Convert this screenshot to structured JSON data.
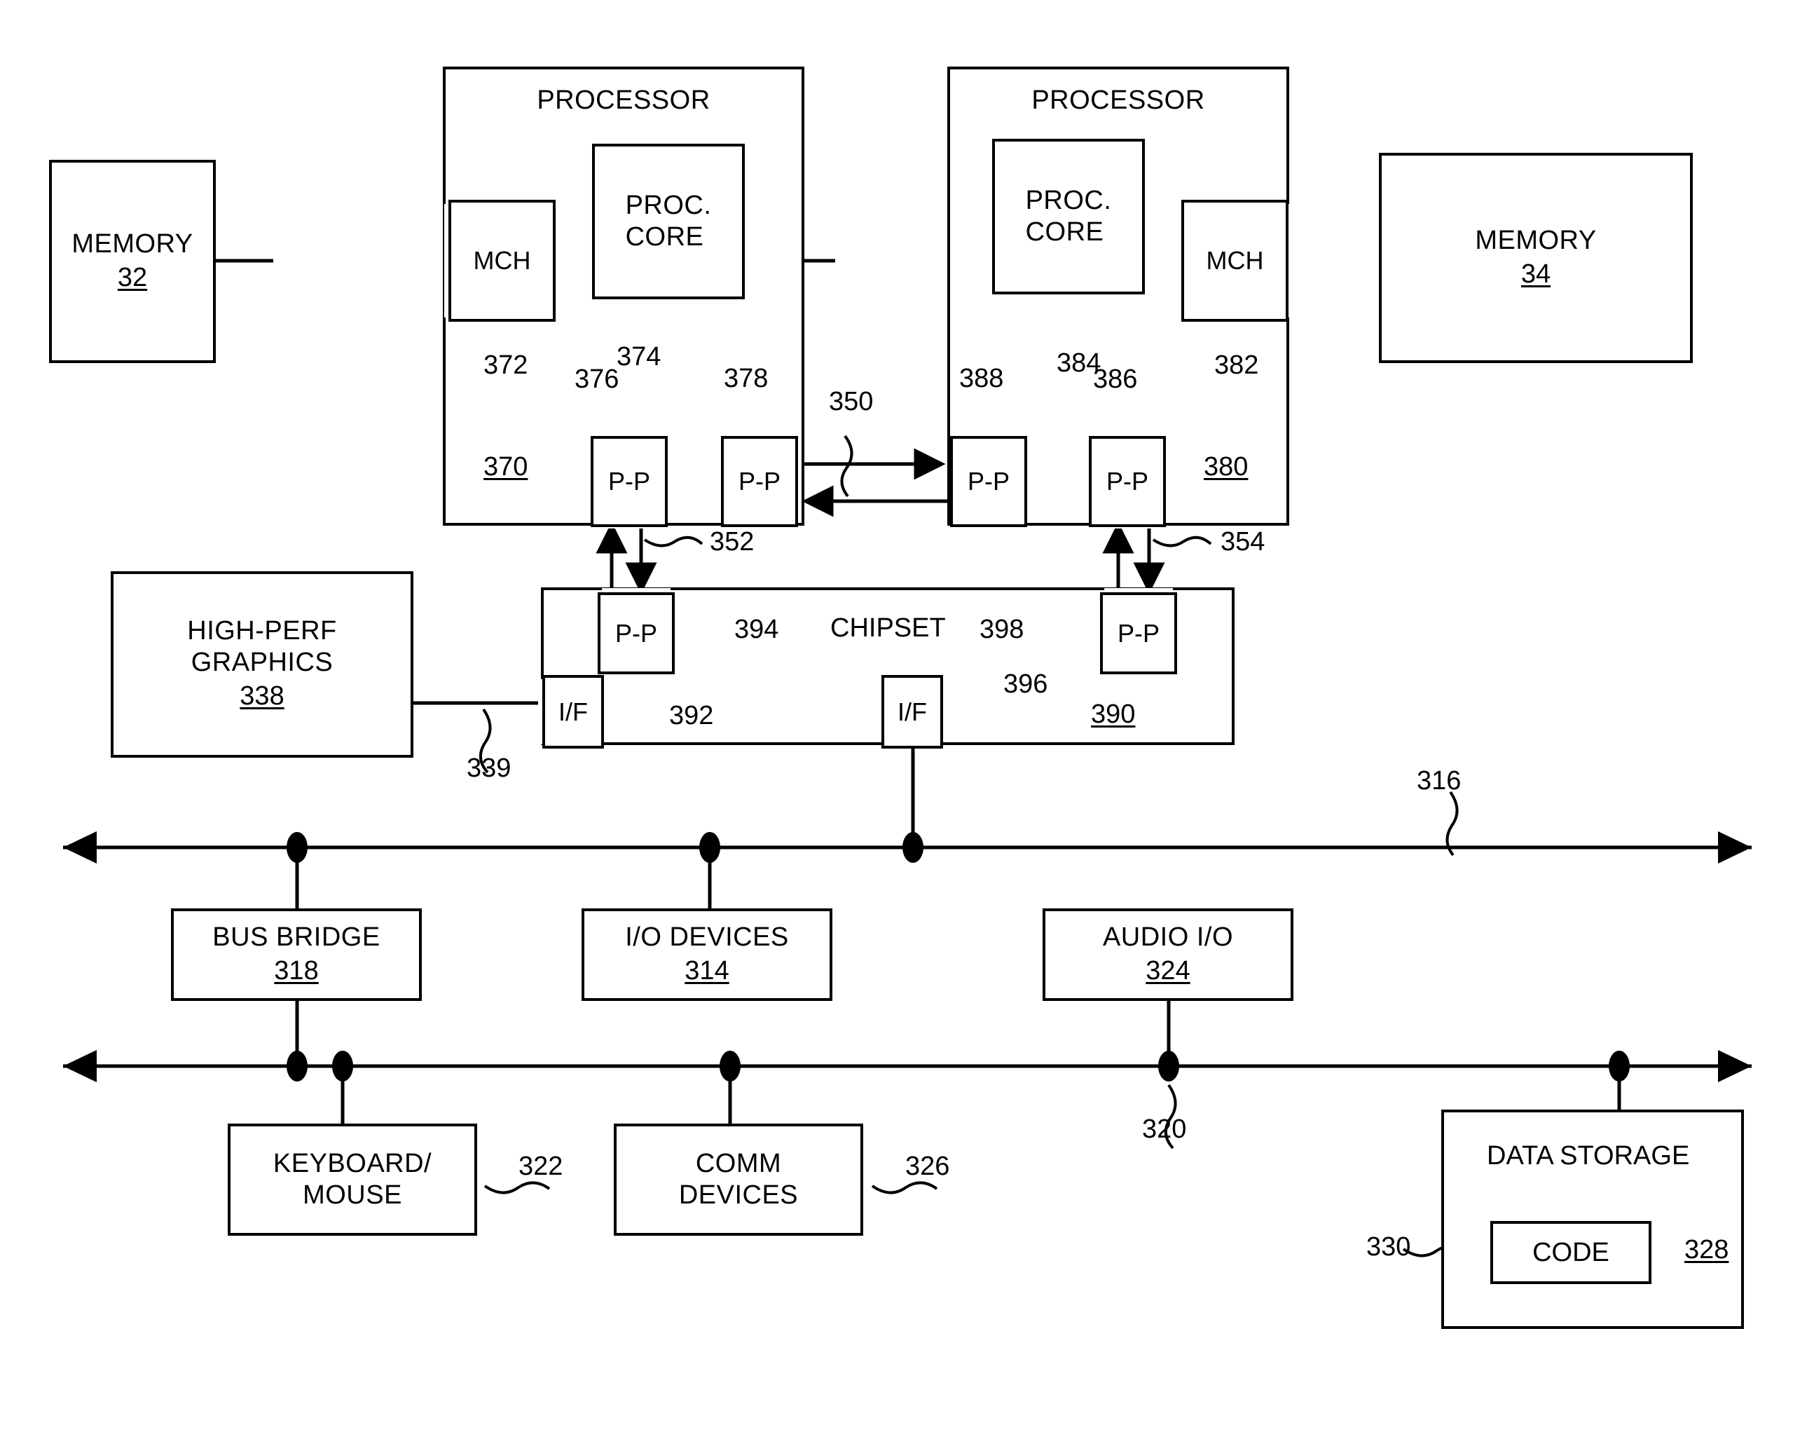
{
  "figure": {
    "type": "patent-block-diagram",
    "description": "Multiprocessor point-to-point interconnect system block diagram"
  },
  "blocks": {
    "memory_left": {
      "title": "MEMORY",
      "ref": "32"
    },
    "memory_right": {
      "title": "MEMORY",
      "ref": "34"
    },
    "processor_left": {
      "title": "PROCESSOR",
      "ref": "370"
    },
    "processor_right": {
      "title": "PROCESSOR",
      "ref": "380"
    },
    "proc_core_left": {
      "title": "PROC.\nCORE",
      "ref": "374"
    },
    "proc_core_right": {
      "title": "PROC.\nCORE",
      "ref": "384"
    },
    "mch_left": {
      "title": "MCH",
      "ref": "372"
    },
    "mch_right": {
      "title": "MCH",
      "ref": "382"
    },
    "pp_left_inner": {
      "title": "P-P",
      "ref": "376"
    },
    "pp_left_outer": {
      "title": "P-P",
      "ref": "378"
    },
    "pp_right_outer": {
      "title": "P-P",
      "ref": "388"
    },
    "pp_right_inner": {
      "title": "P-P",
      "ref": "386"
    },
    "chipset": {
      "title": "CHIPSET",
      "ref": "390"
    },
    "chipset_pp_left": {
      "title": "P-P",
      "ref": "394"
    },
    "chipset_pp_right": {
      "title": "P-P",
      "ref": "398"
    },
    "chipset_if_left": {
      "title": "I/F",
      "ref": "392"
    },
    "chipset_if_right": {
      "title": "I/F",
      "ref": "396"
    },
    "graphics": {
      "title": "HIGH-PERF\nGRAPHICS",
      "ref": "338"
    },
    "bus_bridge": {
      "title": "BUS BRIDGE",
      "ref": "318"
    },
    "io_devices": {
      "title": "I/O DEVICES",
      "ref": "314"
    },
    "audio_io": {
      "title": "AUDIO I/O",
      "ref": "324"
    },
    "keyboard_mouse": {
      "title": "KEYBOARD/\nMOUSE",
      "ref": "322"
    },
    "comm_devices": {
      "title": "COMM\nDEVICES",
      "ref": "326"
    },
    "data_storage": {
      "title": "DATA STORAGE",
      "ref": "328"
    },
    "code": {
      "title": "CODE",
      "ref": "330"
    }
  },
  "link_refs": {
    "interconnect_350": "350",
    "link_352": "352",
    "link_354": "354",
    "graphics_link_339": "339",
    "bus_316": "316",
    "bus_320": "320"
  }
}
